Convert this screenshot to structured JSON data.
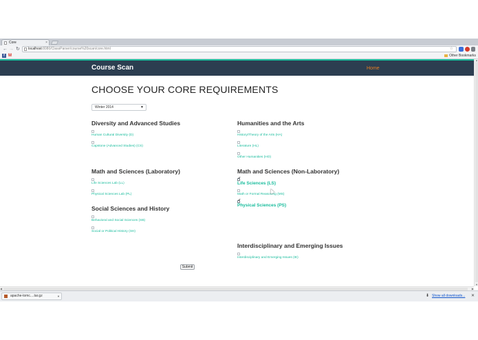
{
  "browser": {
    "tab_title": "Core",
    "tab_close": "×",
    "url_host": "localhost",
    "url_path": ":8080/ClassParser/course%20scan/core.html",
    "bookmarks_other": "Other Bookmarks"
  },
  "site": {
    "brand": "Course Scan",
    "home_link": "Home"
  },
  "page": {
    "heading": "CHOOSE YOUR CORE REQUIREMENTS",
    "term_selected": "Winter 2014",
    "submit_label": "Submit"
  },
  "sections": [
    {
      "title": "Diversity and Advanced Studies",
      "items": [
        {
          "label": "Human Cultural Diversity (D)",
          "checked": false
        },
        {
          "label": "Capstone (Advanced Studies) (CS)",
          "checked": false
        }
      ]
    },
    {
      "title": "Humanities and the Arts",
      "items": [
        {
          "label": "History/Theory of the Arts (HA)",
          "checked": false
        },
        {
          "label": "Literature (HL)",
          "checked": false
        },
        {
          "label": "Other Humanities (HO)",
          "checked": false
        }
      ]
    },
    {
      "title": "Math and Sciences (Laboratory)",
      "items": [
        {
          "label": "Life Sciences Lab (LL)",
          "checked": false
        },
        {
          "label": "Physical Sciences Lab (PL)",
          "checked": false
        }
      ]
    },
    {
      "title": "Math and Sciences (Non-Laboratory)",
      "items": [
        {
          "label": "Life Sciences (LS)",
          "checked": true
        },
        {
          "label": "Math or Formal Reasoning (MS)",
          "checked": false
        },
        {
          "label": "Physical Sciences (PS)",
          "checked": true
        }
      ]
    },
    {
      "title": "Social Sciences and History",
      "items": [
        {
          "label": "Behavioral and Social Sciences (SB)",
          "checked": false
        },
        {
          "label": "Social or Political History (SH)",
          "checked": false
        }
      ]
    },
    {
      "title": "Interdisciplinary and Emerging Issues",
      "items": [
        {
          "label": "Interdisciplinary and Emerging Issues (IE)",
          "checked": false
        }
      ]
    }
  ],
  "downloads": {
    "file_name": "apache-tomc....tar.gz",
    "show_all": "Show all downloads..."
  },
  "colors": {
    "navbar": "#2c3e50",
    "accent": "#18bc9c",
    "home_link": "#e67e22"
  },
  "icons": {
    "back": "back-arrow-icon",
    "forward": "forward-arrow-icon",
    "reload": "reload-icon",
    "bookmark_star": "star-icon",
    "checkmark": "check-icon"
  }
}
